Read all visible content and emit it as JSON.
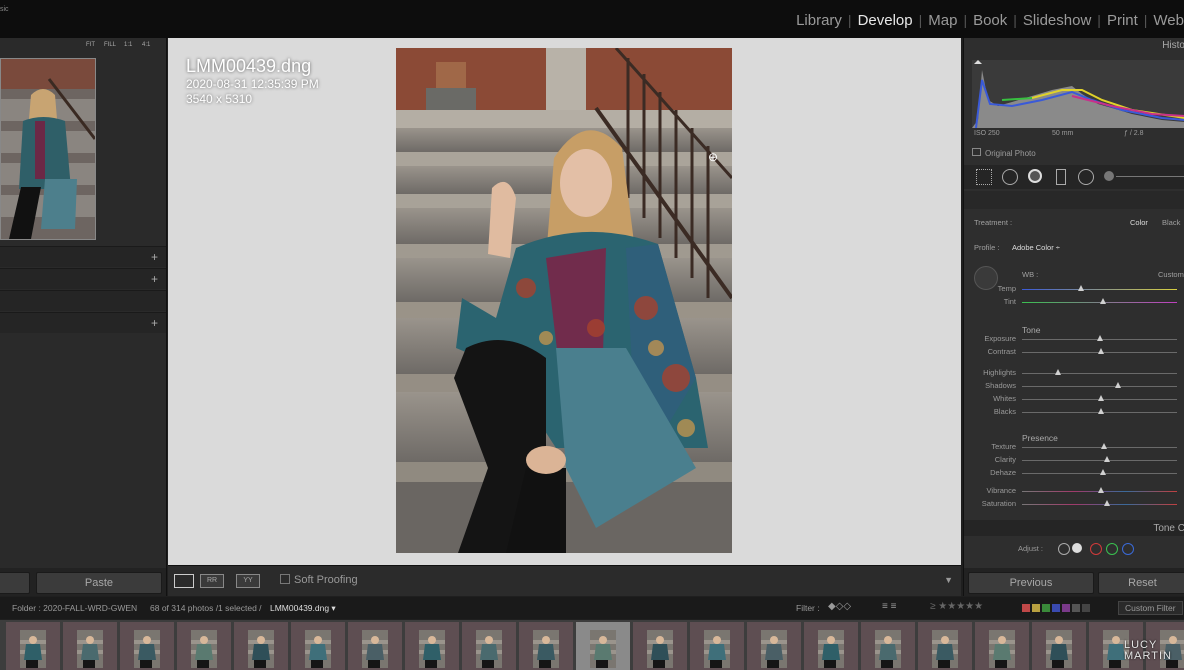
{
  "app": {
    "logo_fragment": "sic"
  },
  "modules": [
    "Library",
    "Develop",
    "Map",
    "Book",
    "Slideshow",
    "Print",
    "Web"
  ],
  "active_module": "Develop",
  "navigator": {
    "options": [
      "FIT",
      "FILL",
      "1:1",
      "4:1"
    ]
  },
  "left_panel": {
    "paste_label": "Paste"
  },
  "image": {
    "filename": "LMM00439.dng",
    "datetime": "2020-08-31 12:35:39 PM",
    "dimensions": "3540 x 5310"
  },
  "toolbar": {
    "soft_proofing_label": "Soft Proofing",
    "view_modes": [
      "RR",
      "YY"
    ]
  },
  "right_panel": {
    "histogram_title": "Histo",
    "exif": {
      "iso": "ISO 250",
      "focal": "50 mm",
      "aperture": "ƒ / 2.8"
    },
    "original_photo_label": "Original Photo",
    "treatment_label": "Treatment :",
    "treatment_options": [
      "Color",
      "Black"
    ],
    "profile_label": "Profile :",
    "profile_value": "Adobe Color ÷",
    "wb_label": "WB :",
    "wb_value": "Custom",
    "groups": {
      "tone": "Tone",
      "presence": "Presence"
    },
    "sliders": {
      "temp": {
        "label": "Temp",
        "value": 0.38
      },
      "tint": {
        "label": "Tint",
        "value": 0.52
      },
      "exposure": {
        "label": "Exposure",
        "value": 0.5
      },
      "contrast": {
        "label": "Contrast",
        "value": 0.51
      },
      "highlights": {
        "label": "Highlights",
        "value": 0.23
      },
      "shadows": {
        "label": "Shadows",
        "value": 0.62
      },
      "whites": {
        "label": "Whites",
        "value": 0.51
      },
      "blacks": {
        "label": "Blacks",
        "value": 0.51
      },
      "texture": {
        "label": "Texture",
        "value": 0.53
      },
      "clarity": {
        "label": "Clarity",
        "value": 0.55
      },
      "dehaze": {
        "label": "Dehaze",
        "value": 0.52
      },
      "vibrance": {
        "label": "Vibrance",
        "value": 0.51
      },
      "saturation": {
        "label": "Saturation",
        "value": 0.55
      }
    },
    "tone_curve_title": "Tone C",
    "adjust_label": "Adjust :",
    "previous_label": "Previous",
    "reset_label": "Reset"
  },
  "filmstrip_bar": {
    "folder": "Folder : 2020-FALL-WRD-GWEN",
    "count": "68 of 314 photos /1 selected /",
    "selected_file": "LMM00439.dng ▾",
    "filter_label": "Filter :",
    "custom_filter_label": "Custom Filter"
  },
  "watermark": {
    "line1": "LUCY",
    "line2": "MARTIN"
  },
  "colors": {
    "active_module": "#e8e8e8",
    "center_bg": "#dadada",
    "panel_bg": "#2e2e2e"
  }
}
